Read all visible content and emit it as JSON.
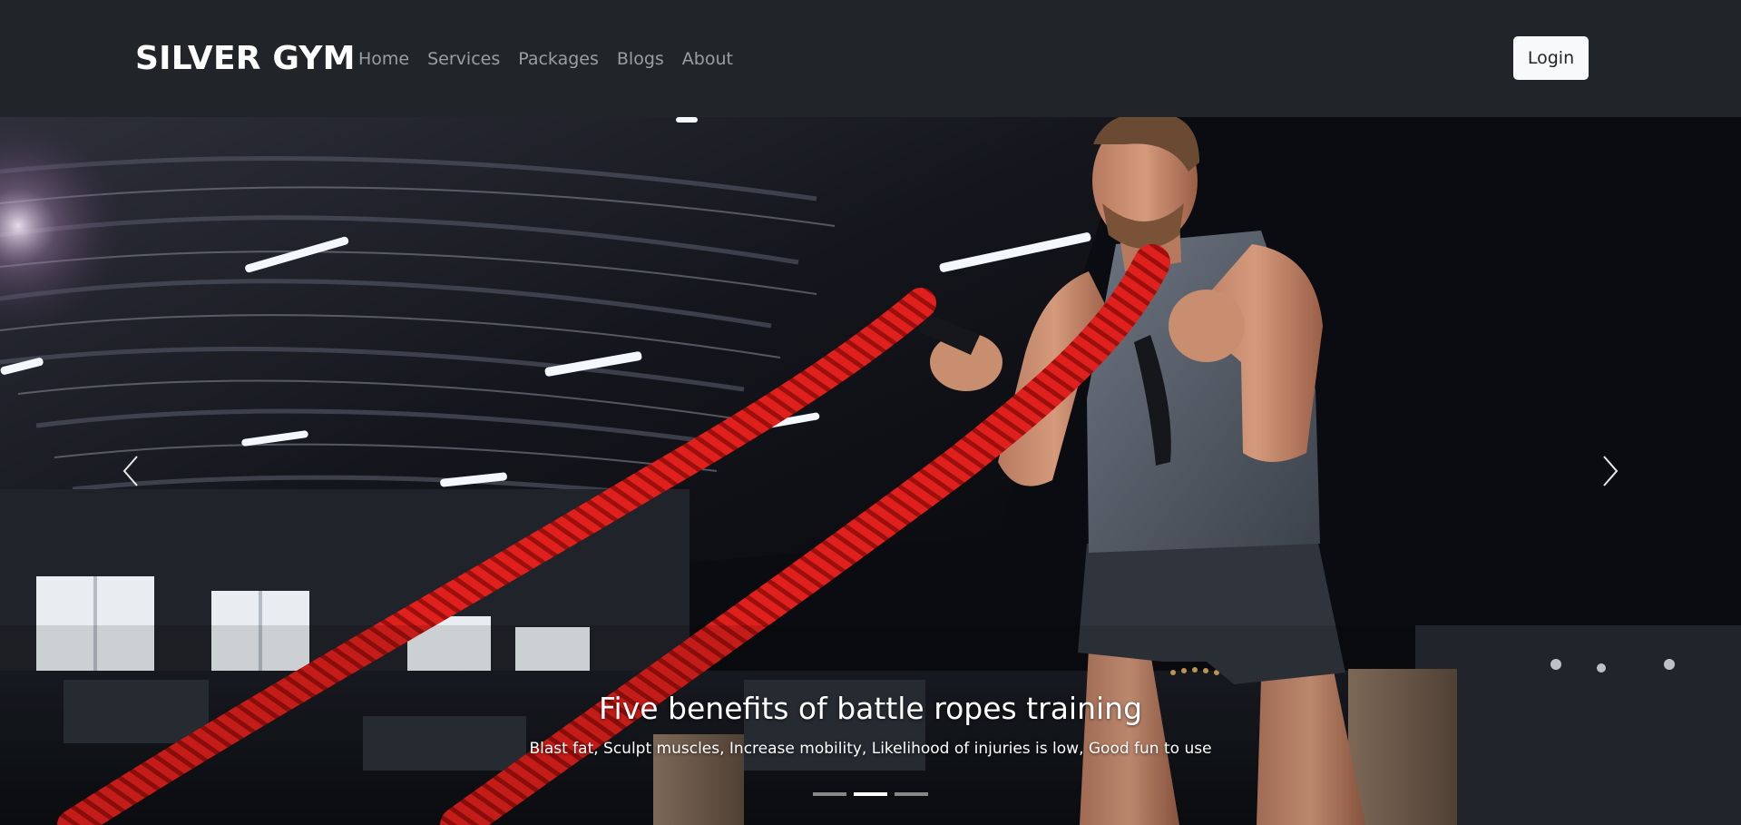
{
  "navbar": {
    "brand": "SILVER GYM",
    "links": [
      "Home",
      "Services",
      "Packages",
      "Blogs",
      "About"
    ],
    "login_label": "Login"
  },
  "carousel": {
    "slide_count": 3,
    "active_index": 1,
    "caption": {
      "title": "Five benefits of battle ropes training",
      "text": "Blast fat, Sculpt muscles, Increase mobility, Likelihood of injuries is low, Good fun to use"
    },
    "icons": {
      "prev": "chevron-left-icon",
      "next": "chevron-right-icon"
    }
  },
  "colors": {
    "navbar_bg": "#212529",
    "nav_link": "#8c8e91",
    "brand": "#ffffff",
    "login_bg": "#f8f9fa",
    "rope": "#e0201c"
  }
}
